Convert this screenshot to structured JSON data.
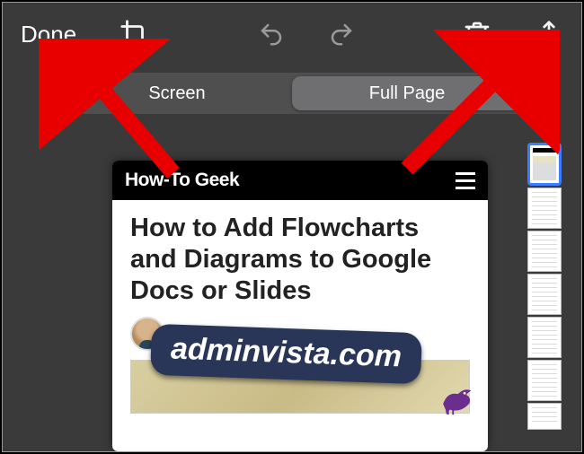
{
  "toolbar": {
    "done_label": "Done"
  },
  "segmented": {
    "screen_label": "Screen",
    "fullpage_label": "Full Page"
  },
  "preview": {
    "site_title": "How-To Geek",
    "article_title": "How to Add Flowcharts and Diagrams to Google Docs or Slides"
  },
  "watermark": {
    "text": "adminvista.com"
  }
}
